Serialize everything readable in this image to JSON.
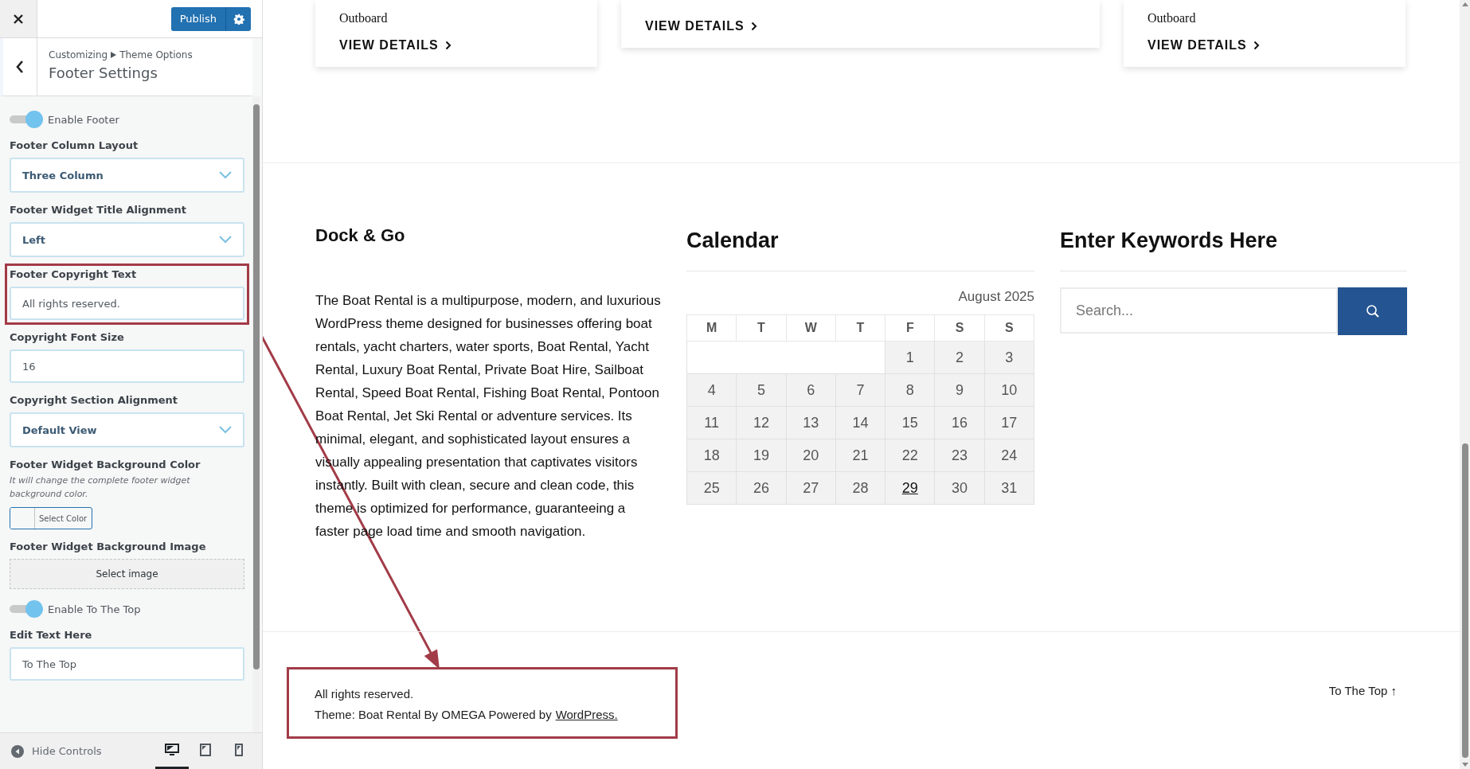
{
  "customizer": {
    "publish": "Publish",
    "breadcrumb": [
      "Customizing",
      "Theme Options"
    ],
    "title": "Footer Settings",
    "controls": [
      {
        "kind": "toggle",
        "label": "Enable Footer",
        "on": true
      },
      {
        "kind": "select",
        "label": "Footer Column Layout",
        "value": "Three Column"
      },
      {
        "kind": "select",
        "label": "Footer Widget Title Alignment",
        "value": "Left"
      },
      {
        "kind": "text",
        "label": "Footer Copyright Text",
        "value": "All rights reserved.",
        "highlighted": true
      },
      {
        "kind": "text",
        "label": "Copyright Font Size",
        "value": "16"
      },
      {
        "kind": "select",
        "label": "Copyright Section Alignment",
        "value": "Default View"
      },
      {
        "kind": "color",
        "label": "Footer Widget Background Color",
        "description": "It will change the complete footer widget background color.",
        "button": "Select Color"
      },
      {
        "kind": "image",
        "label": "Footer Widget Background Image",
        "button": "Select image"
      },
      {
        "kind": "toggle",
        "label": "Enable To The Top",
        "on": true
      },
      {
        "kind": "text",
        "label": "Edit Text Here",
        "value": "To The Top"
      }
    ],
    "hide_controls": "Hide Controls",
    "devices": [
      {
        "kind": "desktop",
        "selected": true
      },
      {
        "kind": "tablet",
        "selected": false
      },
      {
        "kind": "mobile",
        "selected": false
      }
    ]
  },
  "preview": {
    "cards": [
      {
        "text": "Outboard",
        "link": "VIEW DETAILS"
      },
      {
        "link": "VIEW DETAILS"
      },
      {
        "text": "Outboard",
        "link": "VIEW DETAILS"
      }
    ],
    "about": {
      "title": "Dock & Go",
      "body": "The Boat Rental is a multipurpose, modern, and luxurious WordPress theme designed for businesses offering boat rentals, yacht charters, water sports, Boat Rental, Yacht Rental, Luxury Boat Rental, Private Boat Hire, Sailboat Rental, Speed Boat Rental, Fishing Boat Rental, Pontoon Boat Rental, Jet Ski Rental or adventure services. Its minimal, elegant, and sophisticated layout ensures a visually appealing presentation that captivates visitors instantly. Built with clean, secure and clean code, this theme is optimized for performance, guaranteeing a faster page load time and smooth navigation."
    },
    "calendar": {
      "title": "Calendar",
      "month": "August 2025",
      "weekdays": [
        "M",
        "T",
        "W",
        "T",
        "F",
        "S",
        "S"
      ],
      "weeks": [
        [
          {
            "day": "1",
            "today": false
          },
          {
            "day": "2",
            "today": false
          },
          {
            "day": "3",
            "today": false
          }
        ],
        [
          {
            "day": "4",
            "today": false
          },
          {
            "day": "5",
            "today": false
          },
          {
            "day": "6",
            "today": false
          },
          {
            "day": "7",
            "today": false
          },
          {
            "day": "8",
            "today": false
          },
          {
            "day": "9",
            "today": false
          },
          {
            "day": "10",
            "today": false
          }
        ],
        [
          {
            "day": "11",
            "today": false
          },
          {
            "day": "12",
            "today": false
          },
          {
            "day": "13",
            "today": false
          },
          {
            "day": "14",
            "today": false
          },
          {
            "day": "15",
            "today": false
          },
          {
            "day": "16",
            "today": false
          },
          {
            "day": "17",
            "today": false
          }
        ],
        [
          {
            "day": "18",
            "today": false
          },
          {
            "day": "19",
            "today": false
          },
          {
            "day": "20",
            "today": false
          },
          {
            "day": "21",
            "today": false
          },
          {
            "day": "22",
            "today": false
          },
          {
            "day": "23",
            "today": false
          },
          {
            "day": "24",
            "today": false
          }
        ],
        [
          {
            "day": "25",
            "today": false
          },
          {
            "day": "26",
            "today": false
          },
          {
            "day": "27",
            "today": false
          },
          {
            "day": "28",
            "today": false
          },
          {
            "day": "29",
            "today": true
          },
          {
            "day": "30",
            "today": false
          },
          {
            "day": "31",
            "today": false
          }
        ]
      ]
    },
    "search": {
      "title": "Enter Keywords Here",
      "placeholder": "Search..."
    },
    "copyright": {
      "text": "All rights reserved.",
      "credit": "Theme: Boat Rental By OMEGA Powered by",
      "link": "WordPress.",
      "highlighted": true
    },
    "to_top": "To The Top ↑"
  }
}
